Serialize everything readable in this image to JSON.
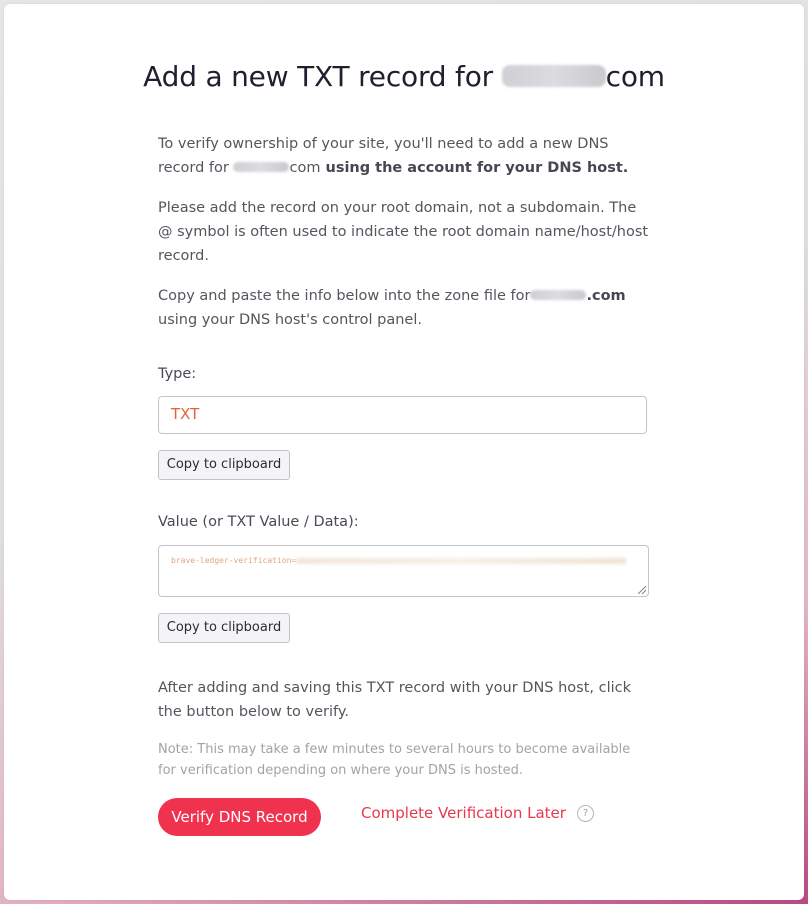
{
  "header": {
    "title_prefix": "Add a new TXT record for ",
    "title_suffix": "com"
  },
  "intro": {
    "p1_a": "To verify ownership of your site, you'll need to add a new DNS record for ",
    "p1_domain_suffix": "com",
    "p1_b": " using the account for your DNS host.",
    "p2": "Please add the record on your root domain, not a subdomain. The @ symbol is often used to indicate the root domain name/host/host record.",
    "p3_a": "Copy and paste the info below into the zone file for",
    "p3_domain_suffix": ".com",
    "p3_b": " using your DNS host's control panel."
  },
  "type_field": {
    "label": "Type:",
    "value": "TXT",
    "copy_label": "Copy to clipboard"
  },
  "value_field": {
    "label": "Value (or TXT Value / Data):",
    "value": "brave-ledger-verification=",
    "copy_label": "Copy to clipboard"
  },
  "footer": {
    "instructions": "After adding and saving this TXT record with your DNS host, click the button below to verify.",
    "note": "Note: This may take a few minutes to several hours to become available for verification depending on where your DNS is hosted.",
    "verify_label": "Verify DNS Record",
    "later_label": "Complete Verification Later",
    "help_glyph": "?"
  },
  "colors": {
    "accent": "#f0324f",
    "type_value": "#e8613a"
  },
  "icons": {
    "help": "question-circle-icon"
  }
}
